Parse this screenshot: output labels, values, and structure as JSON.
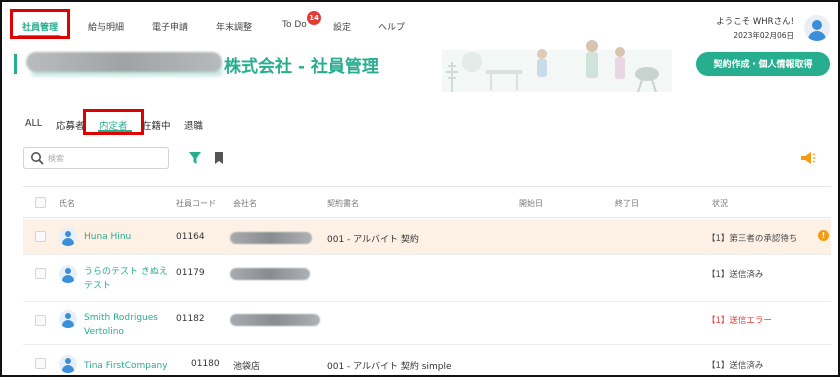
{
  "nav": {
    "items": [
      {
        "label": "社員管理",
        "active": true
      },
      {
        "label": "給与明細"
      },
      {
        "label": "電子申請"
      },
      {
        "label": "年末調整"
      },
      {
        "label": "To Do"
      },
      {
        "label": "設定"
      },
      {
        "label": "ヘルプ"
      }
    ],
    "todo_count": "14"
  },
  "user": {
    "welcome": "ようこそ WHRさん!",
    "date": "2023年02月06日"
  },
  "banner": {
    "company_title": "株式会社 - 社員管理",
    "contract_button": "契約作成・個人情報取得"
  },
  "filter_tabs": [
    {
      "label": "ALL"
    },
    {
      "label": "応募者"
    },
    {
      "label": "内定者",
      "active": true
    },
    {
      "label": "在籍中"
    },
    {
      "label": "退職"
    }
  ],
  "search": {
    "placeholder": "検索"
  },
  "table": {
    "headers": [
      "氏名",
      "社員コード",
      "会社名",
      "契約書名",
      "開始日",
      "終了日",
      "状況"
    ],
    "rows": [
      {
        "name": "Huna Hinu",
        "code": "01164",
        "company": "",
        "contract": "001 - アルバイト 契約",
        "status": "【1】第三者の承認待ち",
        "status_type": "pending",
        "highlight": true,
        "warning": "!"
      },
      {
        "name": "うらのテスト きぬえテスト",
        "code": "01179",
        "company": "",
        "contract": "",
        "status": "【1】送信済み",
        "status_type": "sent"
      },
      {
        "name": "Smith Rodrigues Vertolino",
        "code": "01182",
        "company": "",
        "contract": "",
        "status": "【1】送信エラー",
        "status_type": "error"
      },
      {
        "name": "Tina FirstCompany",
        "code": "01180",
        "company": "池袋店",
        "contract": "001 - アルバイト 契約 simple",
        "status": "【1】送信済み",
        "status_type": "sent"
      }
    ]
  },
  "colors": {
    "accent": "#27ae8f",
    "error": "#e53935",
    "warning": "#f39c12",
    "highlight_row": "#fdf1e6",
    "annotation_box": "#e00000"
  }
}
